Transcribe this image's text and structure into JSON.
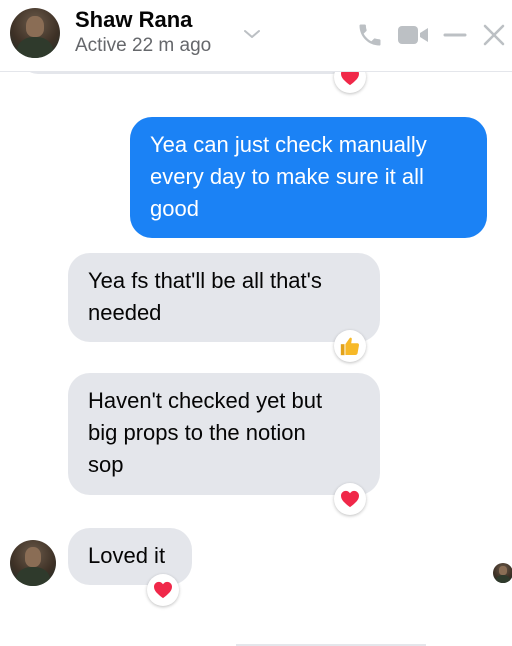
{
  "header": {
    "contact_name": "Shaw Rana",
    "status": "Active 22 m ago",
    "icons": {
      "avatar": "contact-avatar",
      "chevron": "chevron-down-icon",
      "call": "phone-icon",
      "video": "video-camera-icon",
      "minimize": "minimize-icon",
      "close": "close-icon"
    },
    "accent_color": "#bcc0c4"
  },
  "messages": [
    {
      "direction": "outgoing",
      "lines": [
        "Yea can just check manually",
        "every day to make sure it all",
        "good"
      ]
    },
    {
      "direction": "incoming",
      "lines": [
        "Yea fs that'll be all that's",
        "needed"
      ],
      "reaction": "thumbs-up-icon"
    },
    {
      "direction": "incoming",
      "lines": [
        "Haven't checked yet but",
        "big props to the notion",
        "sop"
      ],
      "reaction": "heart-icon"
    },
    {
      "direction": "incoming",
      "lines": [
        "Loved it"
      ],
      "reaction": "heart-icon"
    }
  ],
  "colors": {
    "outgoing_bubble": "#1b82f5",
    "incoming_bubble": "#e4e6eb",
    "heart": "#f02849",
    "thumbs_up": "#f7b928"
  }
}
